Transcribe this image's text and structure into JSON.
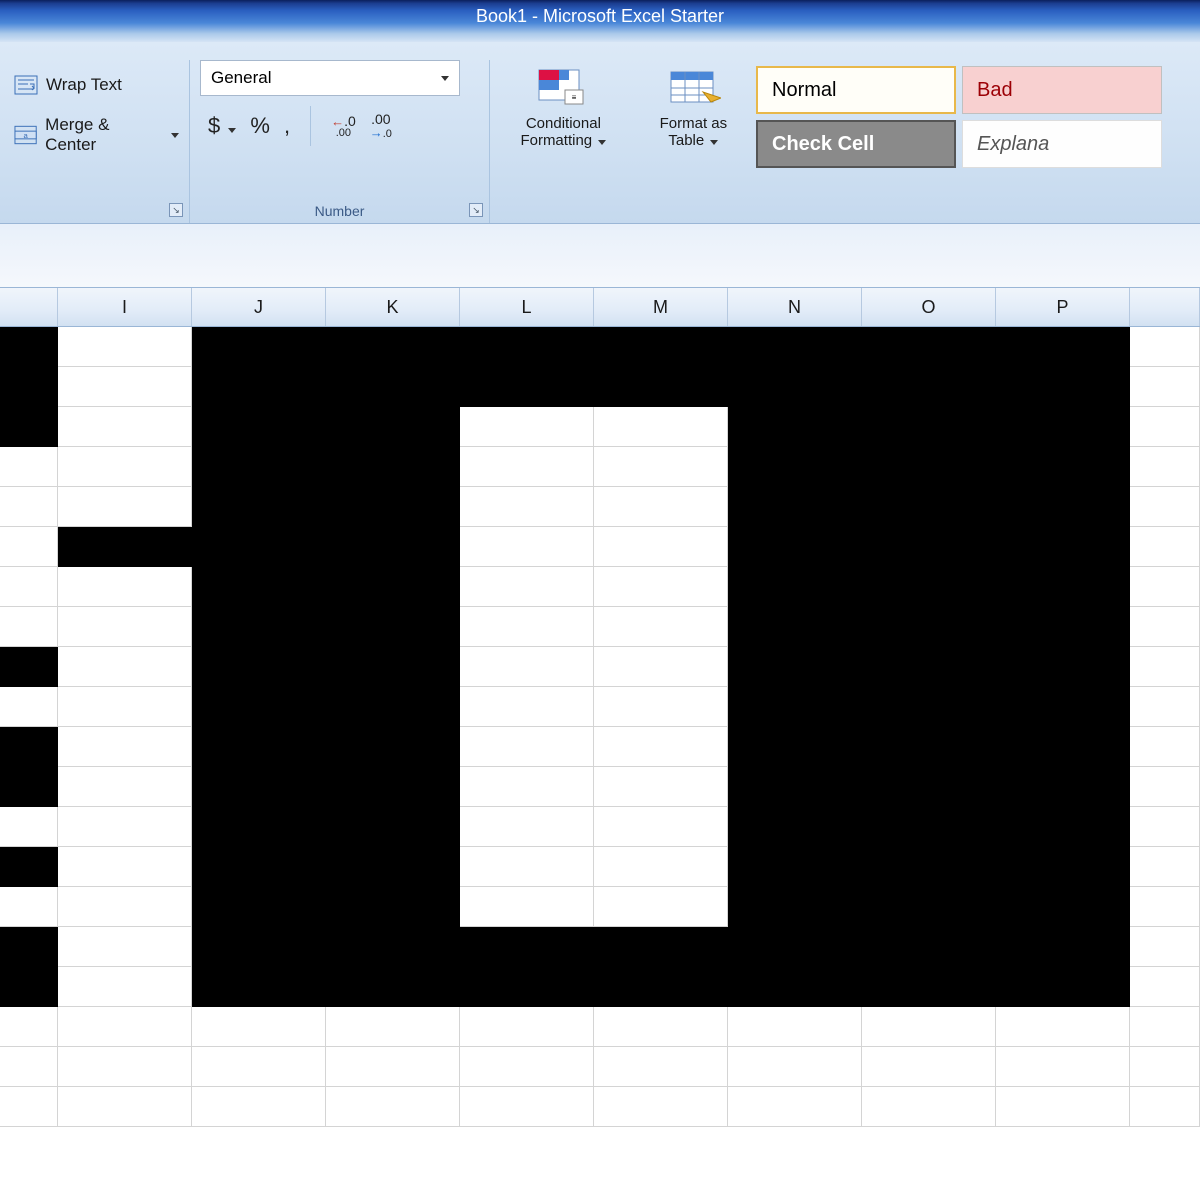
{
  "titlebar": {
    "title": "Book1  -  Microsoft Excel Starter"
  },
  "ribbon": {
    "alignment": {
      "wrap_text": "Wrap Text",
      "merge_center": "Merge & Center"
    },
    "number": {
      "format_selected": "General",
      "currency": "$",
      "percent": "%",
      "comma": ",",
      "inc_dec_label": "←.0 .00",
      "dec_dec_label": ".00 →.0",
      "group_label": "Number"
    },
    "styles": {
      "conditional_formatting": "Conditional Formatting",
      "format_as_table": "Format as Table",
      "cell_styles": {
        "normal": "Normal",
        "bad": "Bad",
        "check_cell": "Check Cell",
        "explanatory": "Explana"
      }
    }
  },
  "columns": [
    "I",
    "J",
    "K",
    "L",
    "M",
    "N",
    "O",
    "P"
  ],
  "black_cells_by_row": [
    [
      0,
      2,
      3,
      4,
      5,
      6,
      7,
      8
    ],
    [
      0,
      2,
      3,
      4,
      5,
      6,
      7,
      8
    ],
    [
      0,
      2,
      3,
      6,
      7,
      8
    ],
    [
      2,
      3,
      6,
      7,
      8
    ],
    [
      2,
      3,
      6,
      7,
      8
    ],
    [
      1,
      2,
      3,
      6,
      7,
      8
    ],
    [
      2,
      3,
      6,
      7,
      8
    ],
    [
      2,
      3,
      6,
      7,
      8
    ],
    [
      0,
      2,
      3,
      6,
      7,
      8
    ],
    [
      2,
      3,
      6,
      7,
      8
    ],
    [
      0,
      2,
      3,
      6,
      7,
      8
    ],
    [
      0,
      2,
      3,
      6,
      7,
      8
    ],
    [
      2,
      3,
      6,
      7,
      8
    ],
    [
      0,
      2,
      3,
      6,
      7,
      8
    ],
    [
      2,
      3,
      6,
      7,
      8
    ],
    [
      0,
      2,
      3,
      4,
      5,
      6,
      7,
      8
    ],
    [
      0,
      2,
      3,
      4,
      5,
      6,
      7,
      8
    ],
    [],
    [],
    []
  ]
}
